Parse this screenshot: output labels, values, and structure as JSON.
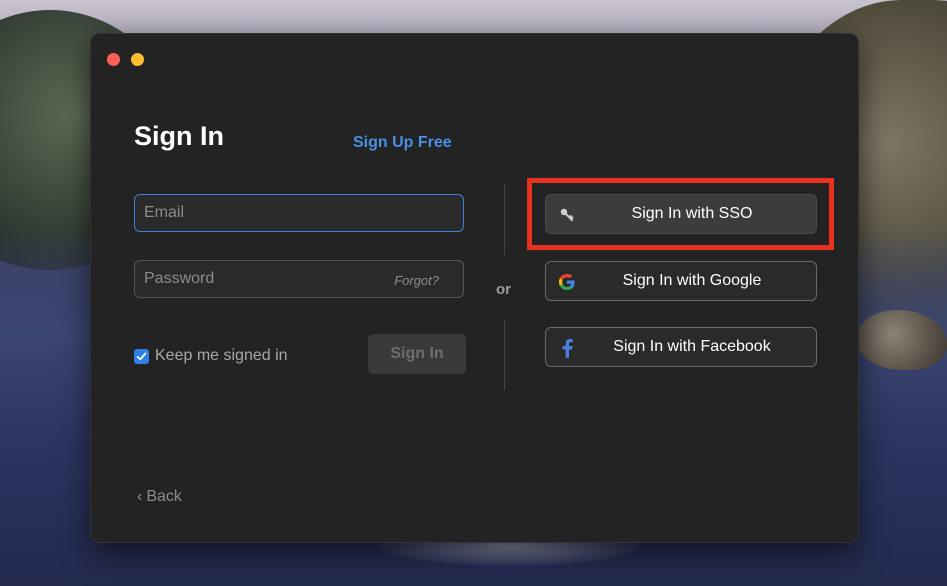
{
  "window": {
    "title": "Sign In",
    "sign_up_link": "Sign Up Free",
    "email": {
      "placeholder": "Email",
      "value": ""
    },
    "password": {
      "placeholder": "Password",
      "value": "",
      "forgot_label": "Forgot?"
    },
    "keep_signed_in": {
      "label": "Keep me signed in",
      "checked": true
    },
    "sign_in_button": "Sign In",
    "or_label": "or",
    "sso_buttons": [
      {
        "label": "Sign In with SSO",
        "icon": "key-icon"
      },
      {
        "label": "Sign In with Google",
        "icon": "google-icon"
      },
      {
        "label": "Sign In with Facebook",
        "icon": "facebook-icon"
      }
    ],
    "back_label": "Back"
  },
  "colors": {
    "window_bg": "#232323",
    "link_blue": "#4a90e2",
    "focus_border": "#3f7fd6",
    "checkbox_blue": "#2f7fe8",
    "highlight_red": "#e8321f",
    "traffic_close": "#ff5f57",
    "traffic_minimize": "#febc2e"
  }
}
